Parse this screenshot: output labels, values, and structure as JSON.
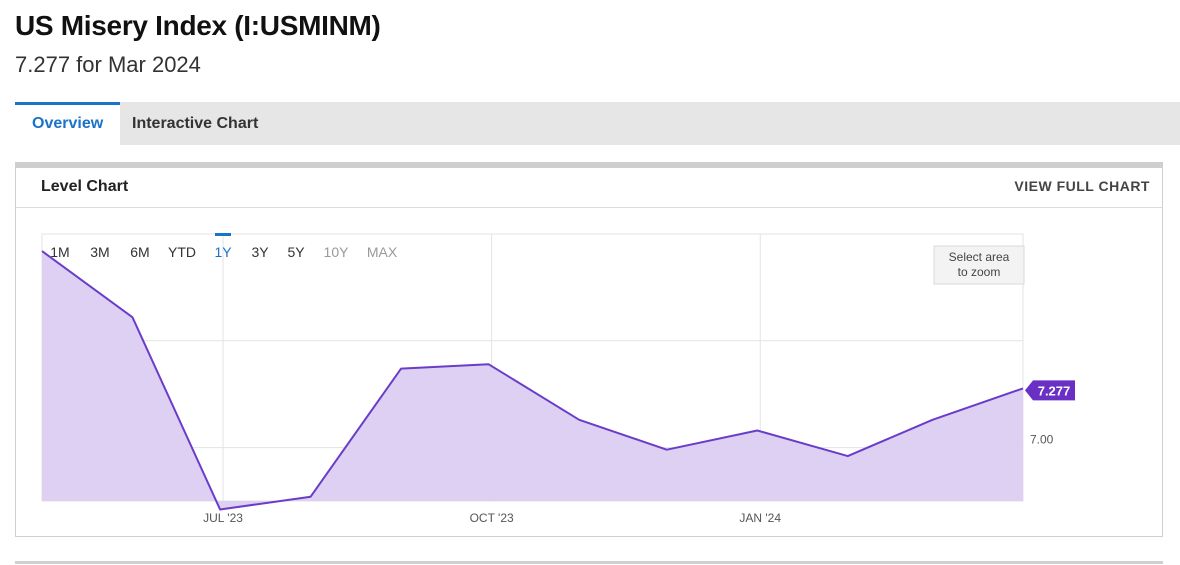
{
  "page": {
    "title": "US Misery Index (I:USMINM)",
    "subtitle": "7.277 for Mar 2024"
  },
  "tabs": [
    {
      "label": "Overview",
      "active": true
    },
    {
      "label": "Interactive Chart",
      "active": false
    }
  ],
  "panel": {
    "title": "Level Chart",
    "view_full_label": "VIEW FULL CHART"
  },
  "range_buttons": [
    {
      "label": "1M",
      "state": "enabled"
    },
    {
      "label": "3M",
      "state": "enabled"
    },
    {
      "label": "6M",
      "state": "enabled"
    },
    {
      "label": "YTD",
      "state": "enabled"
    },
    {
      "label": "1Y",
      "state": "active"
    },
    {
      "label": "3Y",
      "state": "enabled"
    },
    {
      "label": "5Y",
      "state": "enabled"
    },
    {
      "label": "10Y",
      "state": "disabled"
    },
    {
      "label": "MAX",
      "state": "disabled"
    }
  ],
  "zoom_hint": [
    "Select area",
    "to zoom"
  ],
  "colors": {
    "accent": "#1a73c8",
    "line": "#6a3dc8",
    "area": "#dccdf2",
    "badge": "#6a2fc4",
    "grid": "#e3e3e3",
    "disabled": "#9a9a9a"
  },
  "chart_data": {
    "type": "area",
    "x": [
      "2023-05-31",
      "2023-06-30",
      "2023-07-31",
      "2023-08-31",
      "2023-09-30",
      "2023-10-31",
      "2023-11-30",
      "2023-12-31",
      "2024-01-31",
      "2024-02-29",
      "2024-03-31"
    ],
    "values": [
      7.92,
      7.61,
      6.71,
      6.77,
      7.37,
      7.39,
      7.13,
      6.99,
      7.08,
      6.96,
      7.13,
      7.277
    ],
    "x_dates": [
      "2023-04-30",
      "2023-05-31",
      "2023-06-30",
      "2023-07-31",
      "2023-08-31",
      "2023-09-30",
      "2023-10-31",
      "2023-11-30",
      "2023-12-31",
      "2024-01-31",
      "2024-02-29",
      "2024-03-31"
    ],
    "x_ticks": [
      {
        "date": "2023-07-01",
        "label": "JUL '23"
      },
      {
        "date": "2023-10-01",
        "label": "OCT '23"
      },
      {
        "date": "2024-01-01",
        "label": "JAN '24"
      }
    ],
    "y_ticks": [
      7.0
    ],
    "y_tick_labels": [
      "7.00"
    ],
    "ylim": [
      6.75,
      8.0
    ],
    "last_value_label": "7.277",
    "grid": true
  }
}
